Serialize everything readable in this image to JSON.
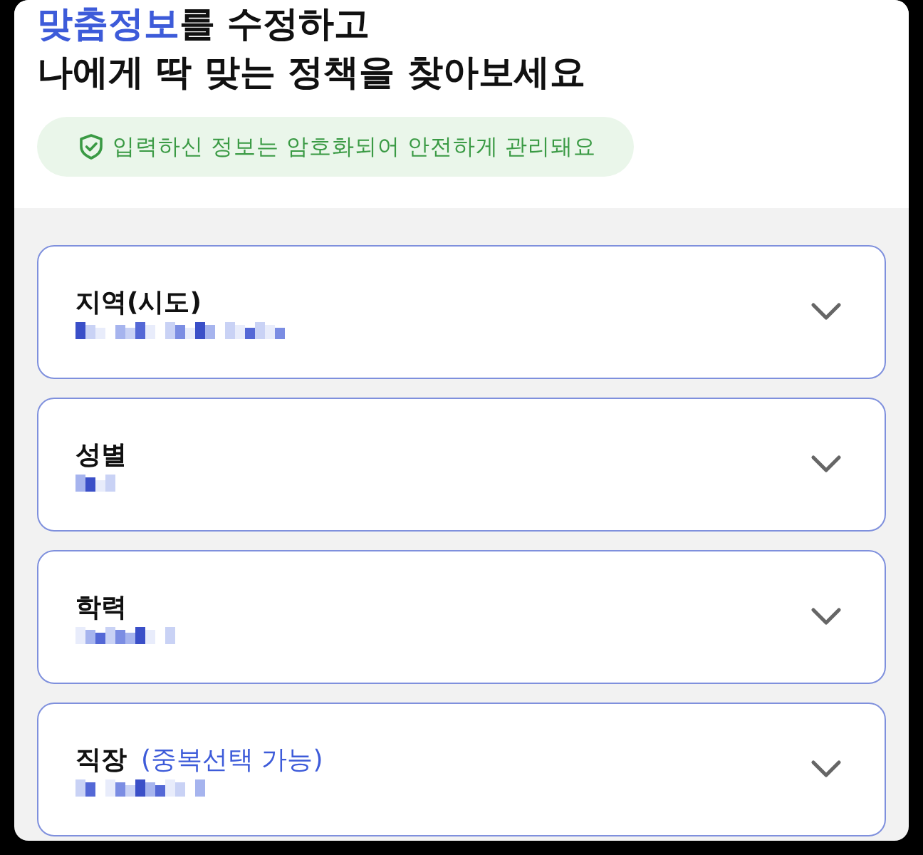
{
  "heading": {
    "highlight": "맞춤정보",
    "rest": "를 수정하고",
    "line2": "나에게 딱 맞는 정책을 찾아보세요"
  },
  "notice": {
    "text": "입력하신 정보는 암호화되어 안전하게 관리돼요"
  },
  "fields": [
    {
      "label": "지역(시도)",
      "value_obscured": true
    },
    {
      "label": "성별",
      "value_obscured": true
    },
    {
      "label": "학력",
      "value_obscured": true
    },
    {
      "label": "직장",
      "note": "(중복선택 가능)",
      "value_obscured": true
    }
  ]
}
